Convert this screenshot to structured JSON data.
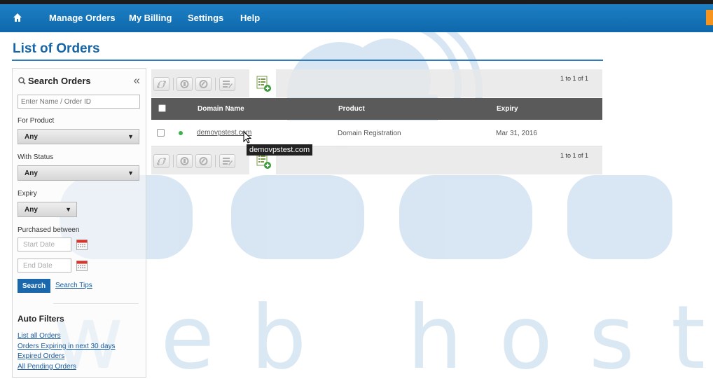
{
  "nav": {
    "items": [
      {
        "label": "Manage Orders"
      },
      {
        "label": "My Billing"
      },
      {
        "label": "Settings"
      },
      {
        "label": "Help"
      }
    ]
  },
  "page": {
    "title": "List of Orders"
  },
  "sidebar": {
    "title": "Search Orders",
    "collapse_glyph": "«",
    "search_placeholder": "Enter Name / Order ID",
    "product_label": "For Product",
    "product_value": "Any",
    "status_label": "With Status",
    "status_value": "Any",
    "expiry_label": "Expiry",
    "expiry_value": "Any",
    "purchased_label": "Purchased between",
    "start_placeholder": "Start Date",
    "end_placeholder": "End Date",
    "search_button": "Search",
    "search_tips": "Search Tips"
  },
  "auto_filters": {
    "title": "Auto Filters",
    "links": [
      "List all Orders",
      "Orders Expiring in next 30 days",
      "Expired Orders",
      "All Pending Orders"
    ]
  },
  "grid": {
    "pager": "1 to 1 of 1",
    "columns": [
      "Domain Name",
      "Product",
      "Expiry"
    ],
    "rows": [
      {
        "domain": "demovpstest.com",
        "product": "Domain Registration",
        "expiry": "Mar 31, 2016",
        "status_color": "#3bb34a"
      }
    ],
    "tooltip": "demovpstest.com"
  },
  "watermark": {
    "word1": "accu",
    "word2": "web hosting",
    "color": "#2d7cc0"
  },
  "colors": {
    "nav": "#1a73b8",
    "title": "#1565a7",
    "accent_orange": "#f7941d"
  }
}
